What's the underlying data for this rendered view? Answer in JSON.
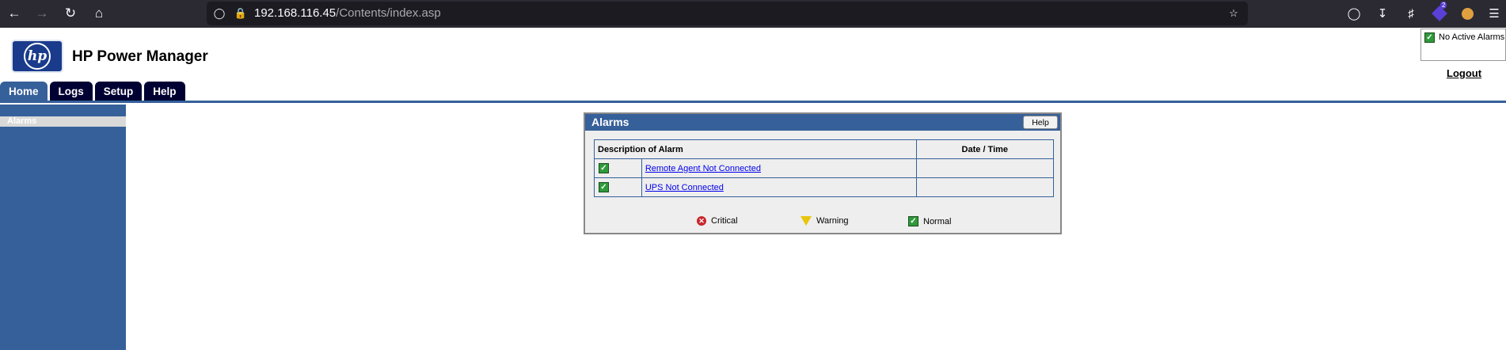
{
  "browser": {
    "url_host": "192.168.116.45",
    "url_path": "/Contents/index.asp",
    "extensions_badge": "2"
  },
  "app": {
    "title": "HP Power Manager",
    "logo_text": "hp"
  },
  "tabs": [
    {
      "label": "Home",
      "active": true
    },
    {
      "label": "Logs",
      "active": false
    },
    {
      "label": "Setup",
      "active": false
    },
    {
      "label": "Help",
      "active": false
    }
  ],
  "alarm_status": {
    "text": "No Active Alarms"
  },
  "logout_label": "Logout",
  "sidebar": {
    "items": [
      {
        "label": "Alarms"
      }
    ]
  },
  "alarms_panel": {
    "title": "Alarms",
    "help_label": "Help",
    "columns": [
      "Description of Alarm",
      "Date / Time"
    ],
    "rows": [
      {
        "status": "normal",
        "description": "Remote Agent Not Connected",
        "datetime": ""
      },
      {
        "status": "normal",
        "description": "UPS Not Connected",
        "datetime": ""
      }
    ],
    "legend": [
      {
        "status": "critical",
        "label": "Critical"
      },
      {
        "status": "warning",
        "label": "Warning"
      },
      {
        "status": "normal",
        "label": "Normal"
      }
    ]
  },
  "colors": {
    "nav_blue": "#36609a",
    "tab_dark": "#000033",
    "normal_green": "#2f9a3a",
    "critical_red": "#c9252c",
    "warning_yellow": "#e8c50b"
  }
}
